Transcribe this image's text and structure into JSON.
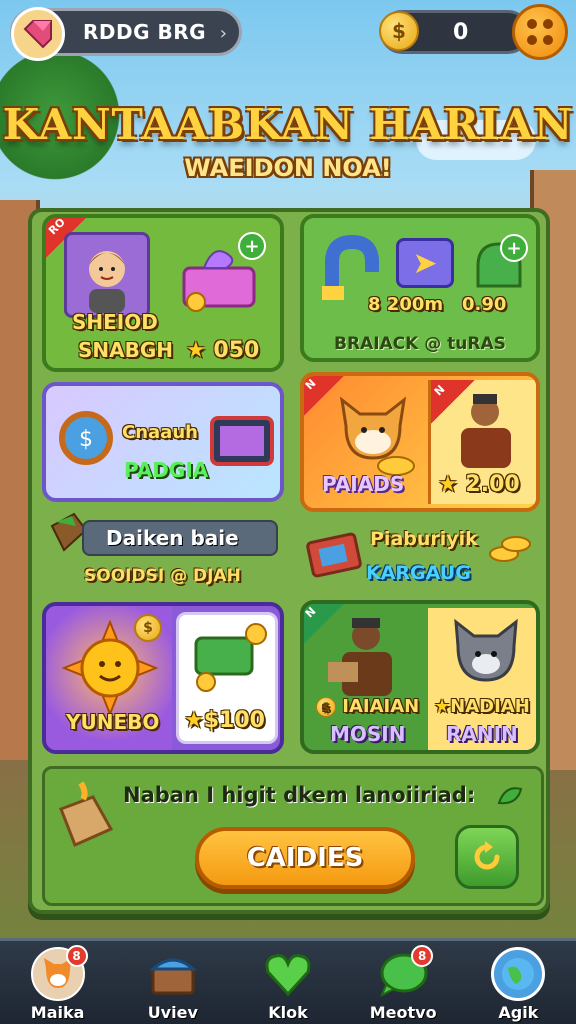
{
  "header": {
    "profile_name": "RDDG BRG",
    "coins": "0"
  },
  "title": "KANTAABKAN HARIAN",
  "subtitle": "WAEIDON NOA!",
  "cards": {
    "a": {
      "label1": "SHEIOD",
      "label2": "SNABGH",
      "price": "050"
    },
    "b": {
      "stat": "200m",
      "stat2": "0.90",
      "label": "BRAIACK @ tuRAS"
    },
    "c": {
      "label1": "Cnaauh",
      "label2": "PADGIA"
    },
    "d": {
      "label": "PAIADS",
      "price": "2.00"
    },
    "g": {
      "tag": "Daiken baie",
      "label": "SOOIDSI @ DJAH"
    },
    "h": {
      "label1": "Piaburiyik",
      "label2": "KARGAUG"
    },
    "e": {
      "label": "YUNEBO",
      "price": "$100"
    },
    "f": {
      "label1": "IAIAIAN",
      "label2": "MOSIN",
      "label3": "NADIAH",
      "label4": "RANIN"
    }
  },
  "ribbons": {
    "a": "RO",
    "d1": "N",
    "d2": "N"
  },
  "bottom": {
    "info_text": "Naban I higit dkem lanoiiriad:",
    "claim_button": "CAIDIES"
  },
  "nav": [
    {
      "label": "Maika",
      "badge": "8"
    },
    {
      "label": "Uviev",
      "badge": ""
    },
    {
      "label": "Klok",
      "badge": ""
    },
    {
      "label": "Meotvo",
      "badge": "8"
    },
    {
      "label": "Agik",
      "badge": ""
    }
  ],
  "colors": {
    "accent": "#ffd23f",
    "board": "#7bb04a",
    "button": "#f59a12"
  }
}
